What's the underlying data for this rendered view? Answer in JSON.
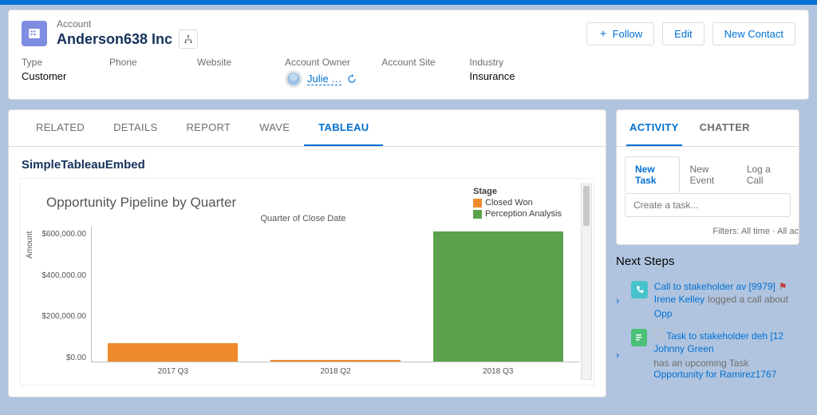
{
  "record": {
    "object_label": "Account",
    "name": "Anderson638 Inc",
    "actions": {
      "follow": "Follow",
      "edit": "Edit",
      "new_contact": "New Contact"
    },
    "fields": {
      "type": {
        "label": "Type",
        "value": "Customer"
      },
      "phone": {
        "label": "Phone",
        "value": ""
      },
      "website": {
        "label": "Website",
        "value": ""
      },
      "owner": {
        "label": "Account Owner",
        "value": "Julie …"
      },
      "site": {
        "label": "Account Site",
        "value": ""
      },
      "industry": {
        "label": "Industry",
        "value": "Insurance"
      }
    }
  },
  "tabs": [
    "RELATED",
    "DETAILS",
    "REPORT",
    "WAVE",
    "TABLEAU"
  ],
  "active_tab": "TABLEAU",
  "embed_title": "SimpleTableauEmbed",
  "chart_data": {
    "type": "bar",
    "title": "Opportunity Pipeline by Quarter",
    "subtitle": "Quarter of Close Date",
    "ylabel": "Amount",
    "ylim": [
      0,
      600000
    ],
    "yticks": [
      "$600,000.00",
      "$400,000.00",
      "$200,000.00",
      "$0.00"
    ],
    "categories": [
      "2017 Q3",
      "2018 Q2",
      "2018 Q3"
    ],
    "series": [
      {
        "name": "Closed Won",
        "color": "#ef8b2c",
        "values": [
          80000,
          8000,
          0
        ]
      },
      {
        "name": "Perception Analysis",
        "color": "#5aa24b",
        "values": [
          0,
          0,
          580000
        ]
      }
    ],
    "legend_title": "Stage"
  },
  "side": {
    "tabs": [
      "ACTIVITY",
      "CHATTER"
    ],
    "active": "ACTIVITY",
    "task_tabs": [
      "New Task",
      "New Event",
      "Log a Call"
    ],
    "task_active": "New Task",
    "task_placeholder": "Create a task...",
    "filter_text": "Filters: All time · All ac",
    "next_steps_title": "Next Steps",
    "steps": [
      {
        "icon": "call",
        "title": "Call to stakeholder av [9979]",
        "who": "Irene Kelley",
        "verb": "logged a call about",
        "obj": "Opp",
        "flagged": true
      },
      {
        "icon": "task",
        "title": "Task to stakeholder deh [12",
        "who": "Johnny Green",
        "verb": "has an upcoming Task",
        "obj": "",
        "flagged": false,
        "checkbox": true,
        "extra_link": "Opportunity for Ramirez1767"
      }
    ]
  }
}
